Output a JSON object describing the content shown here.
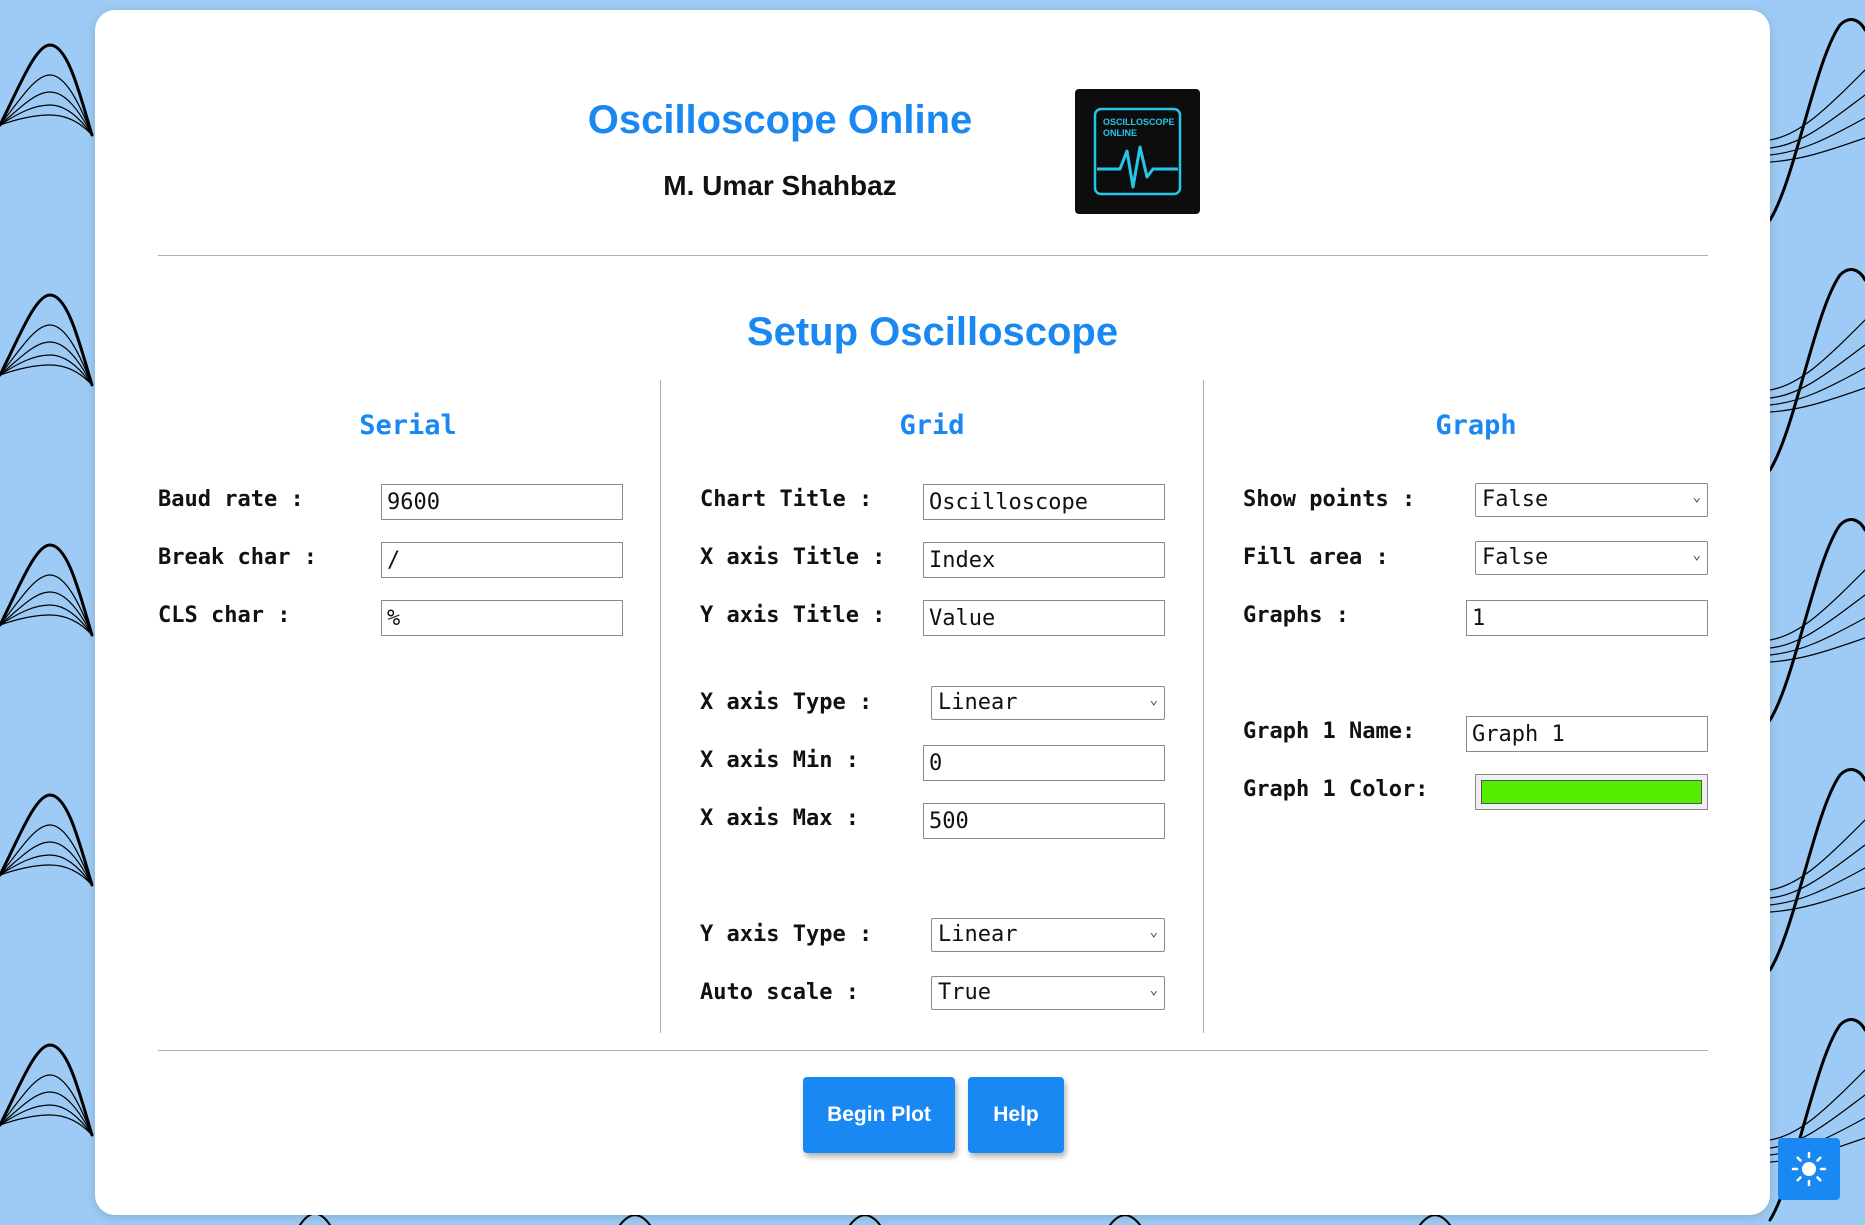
{
  "header": {
    "title": "Oscilloscope Online",
    "author": "M. Umar Shahbaz",
    "logo_text": "OSCILLOSCOPE\nONLINE"
  },
  "setup_title": "Setup Oscilloscope",
  "serial": {
    "title": "Serial",
    "baud_rate_label": "Baud rate :",
    "baud_rate_value": "9600",
    "break_char_label": "Break char :",
    "break_char_value": "/",
    "cls_char_label": "CLS char :",
    "cls_char_value": "%"
  },
  "grid": {
    "title": "Grid",
    "chart_title_label": "Chart Title :",
    "chart_title_value": "Oscilloscope",
    "x_axis_title_label": "X axis Title :",
    "x_axis_title_value": "Index",
    "y_axis_title_label": "Y axis Title :",
    "y_axis_title_value": "Value",
    "x_axis_type_label": "X axis Type :",
    "x_axis_type_value": "Linear",
    "x_axis_min_label": "X axis Min :",
    "x_axis_min_value": "0",
    "x_axis_max_label": "X axis Max :",
    "x_axis_max_value": "500",
    "y_axis_type_label": "Y axis Type :",
    "y_axis_type_value": "Linear",
    "auto_scale_label": "Auto scale :",
    "auto_scale_value": "True"
  },
  "graph": {
    "title": "Graph",
    "show_points_label": "Show points :",
    "show_points_value": "False",
    "fill_area_label": "Fill area :",
    "fill_area_value": "False",
    "graphs_label": "Graphs :",
    "graphs_value": "1",
    "graph1_name_label": "Graph 1 Name:",
    "graph1_name_value": "Graph 1",
    "graph1_color_label": "Graph 1 Color:",
    "graph1_color_value": "#55ee00"
  },
  "buttons": {
    "begin_plot": "Begin Plot",
    "help": "Help"
  },
  "colors": {
    "accent": "#1a88f2",
    "background": "#9ecbf5"
  },
  "icons": {
    "theme_toggle": "sun-icon",
    "select_arrow": "chevron-down-icon"
  }
}
